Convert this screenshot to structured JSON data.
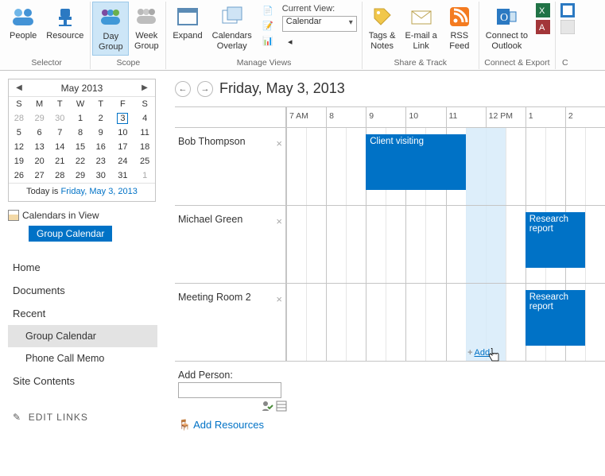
{
  "ribbon": {
    "selector": {
      "people": "People",
      "resource": "Resource",
      "group_label": "Selector"
    },
    "scope": {
      "day_group": "Day\nGroup",
      "week_group": "Week\nGroup",
      "group_label": "Scope"
    },
    "manage_views": {
      "expand": "Expand",
      "cal_overlay": "Calendars\nOverlay",
      "current_view_label": "Current View:",
      "current_view_value": "Calendar",
      "group_label": "Manage Views"
    },
    "share_track": {
      "tags_notes": "Tags &\nNotes",
      "email_link": "E-mail a\nLink",
      "rss_feed": "RSS\nFeed",
      "group_label": "Share & Track"
    },
    "connect_export": {
      "connect_outlook": "Connect to\nOutlook",
      "group_label": "Connect & Export"
    }
  },
  "minical": {
    "title": "May 2013",
    "dow": [
      "S",
      "M",
      "T",
      "W",
      "T",
      "F",
      "S"
    ],
    "grid": [
      [
        {
          "d": 28,
          "m": 1
        },
        {
          "d": 29,
          "m": 1
        },
        {
          "d": 30,
          "m": 1
        },
        {
          "d": 1
        },
        {
          "d": 2
        },
        {
          "d": 3,
          "sel": 1
        },
        {
          "d": 4
        }
      ],
      [
        {
          "d": 5
        },
        {
          "d": 6
        },
        {
          "d": 7
        },
        {
          "d": 8
        },
        {
          "d": 9
        },
        {
          "d": 10
        },
        {
          "d": 11
        }
      ],
      [
        {
          "d": 12
        },
        {
          "d": 13
        },
        {
          "d": 14
        },
        {
          "d": 15
        },
        {
          "d": 16
        },
        {
          "d": 17
        },
        {
          "d": 18
        }
      ],
      [
        {
          "d": 19
        },
        {
          "d": 20
        },
        {
          "d": 21
        },
        {
          "d": 22
        },
        {
          "d": 23
        },
        {
          "d": 24
        },
        {
          "d": 25
        }
      ],
      [
        {
          "d": 26
        },
        {
          "d": 27
        },
        {
          "d": 28
        },
        {
          "d": 29
        },
        {
          "d": 30
        },
        {
          "d": 31
        },
        {
          "d": 1,
          "m": 1
        }
      ]
    ],
    "today_prefix": "Today is ",
    "today_link": "Friday, May 3, 2013"
  },
  "calinview": {
    "title": "Calendars in View",
    "badge": "Group Calendar"
  },
  "leftnav": {
    "items": [
      {
        "label": "Home"
      },
      {
        "label": "Documents"
      },
      {
        "label": "Recent"
      },
      {
        "label": "Group Calendar",
        "sub": 1,
        "active": 1
      },
      {
        "label": "Phone Call Memo",
        "sub": 1
      },
      {
        "label": "Site Contents"
      }
    ],
    "edit_links": "EDIT LINKS"
  },
  "day": {
    "title": "Friday, May 3, 2013"
  },
  "hours": [
    "7 AM",
    "8",
    "9",
    "10",
    "11",
    "12 PM",
    "1",
    "2"
  ],
  "resources": [
    {
      "name": "Bob Thompson",
      "events": [
        {
          "title": "Client visiting",
          "start": 9,
          "end": 11.5
        }
      ]
    },
    {
      "name": "Michael Green",
      "events": [
        {
          "title": "Research report",
          "start": 13,
          "end": 14.5
        }
      ]
    },
    {
      "name": "Meeting Room 2",
      "events": [
        {
          "title": "Research report",
          "start": 13,
          "end": 14.5
        }
      ],
      "addlink": true
    }
  ],
  "now_hour": 11.7,
  "add_label": "Add",
  "addperson": {
    "label": "Add Person:",
    "value": ""
  },
  "addresources": {
    "label": "Add Resources"
  }
}
